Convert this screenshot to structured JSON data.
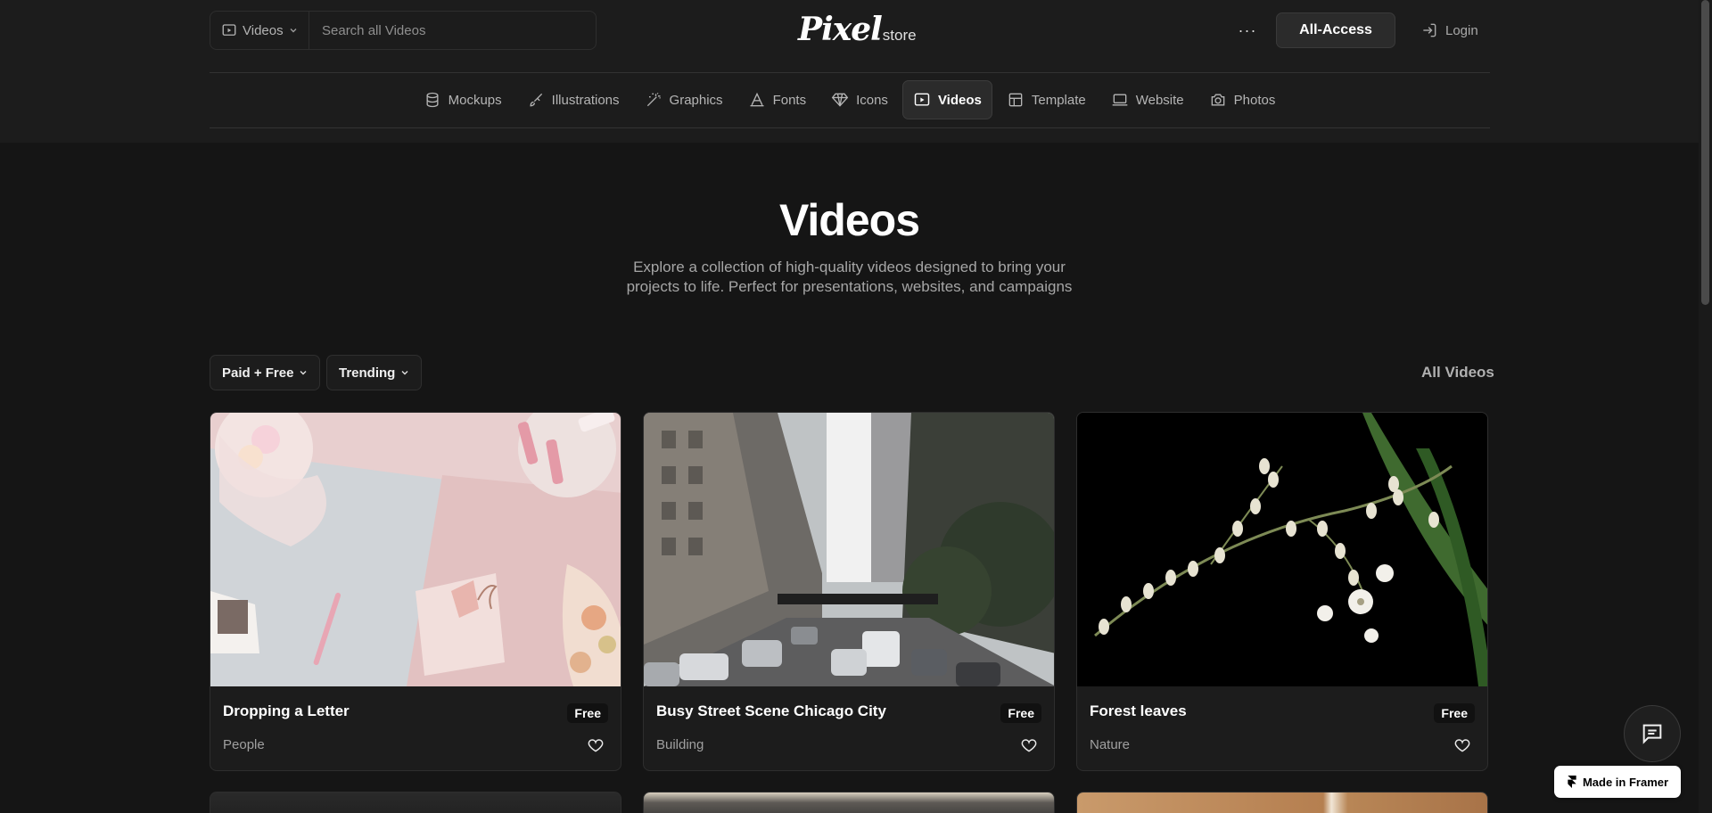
{
  "search": {
    "category": "Videos",
    "placeholder": "Search all Videos"
  },
  "logo": {
    "main": "Pixel",
    "sub": "store"
  },
  "header": {
    "more": "···",
    "all_access": "All-Access",
    "login": "Login"
  },
  "nav": [
    {
      "label": "Mockups",
      "icon": "database-icon"
    },
    {
      "label": "Illustrations",
      "icon": "brush-icon"
    },
    {
      "label": "Graphics",
      "icon": "wand-icon"
    },
    {
      "label": "Fonts",
      "icon": "type-icon"
    },
    {
      "label": "Icons",
      "icon": "diamond-icon"
    },
    {
      "label": "Videos",
      "icon": "video-icon",
      "active": true
    },
    {
      "label": "Template",
      "icon": "layout-icon"
    },
    {
      "label": "Website",
      "icon": "laptop-icon"
    },
    {
      "label": "Photos",
      "icon": "camera-icon"
    }
  ],
  "hero": {
    "title": "Videos",
    "subtitle": "Explore a collection of high-quality videos designed to bring your projects to life. Perfect for presentations, websites, and campaigns"
  },
  "filters": {
    "pricing": "Paid + Free",
    "sort": "Trending",
    "all_link": "All Videos"
  },
  "cards": [
    {
      "title": "Dropping a Letter",
      "badge": "Free",
      "category": "People"
    },
    {
      "title": "Busy Street Scene Chicago City",
      "badge": "Free",
      "category": "Building"
    },
    {
      "title": "Forest leaves",
      "badge": "Free",
      "category": "Nature"
    }
  ],
  "framer_badge": "Made in Framer"
}
